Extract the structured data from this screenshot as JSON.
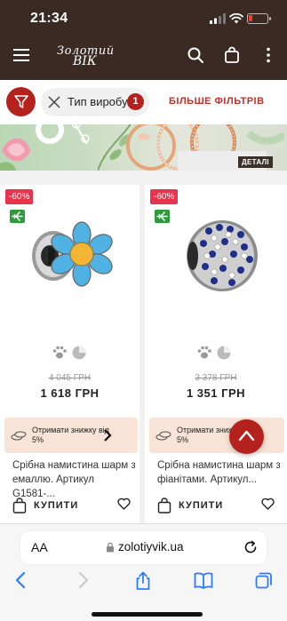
{
  "status_bar": {
    "time": "21:34"
  },
  "header": {
    "logo_line1": "Золотий",
    "logo_line2": "ВІК"
  },
  "filters": {
    "chip_label": "Тип виробу",
    "chip_count": "1",
    "more_filters": "БІЛЬШЕ ФІЛЬТРІВ"
  },
  "banner": {
    "percent_text": "%",
    "button_label": "ДЕТАЛІ"
  },
  "products": [
    {
      "discount": "-60%",
      "old_price": "4 045 ГРН",
      "price": "1 618 ГРН",
      "promo_text": "Отримати знижку від 5%",
      "title": "Срібна намистина шарм з емаллю. Артикул G1581-...",
      "buy_label": "КУПИТИ"
    },
    {
      "discount": "-60%",
      "old_price": "3 378 ГРН",
      "price": "1 351 ГРН",
      "promo_text": "Отримати знижку від 5%",
      "title": "Срібна намистина шарм з фіанітами. Артикул...",
      "buy_label": "КУПИТИ"
    }
  ],
  "browser": {
    "aa_label": "AA",
    "url": "zolotiyvik.ua"
  },
  "colors": {
    "header_bg": "#3b2a24",
    "accent_red": "#b5221e",
    "discount_pink": "#e5344c",
    "express_green": "#2e9a3c",
    "promo_bg": "#f8e4d6"
  }
}
